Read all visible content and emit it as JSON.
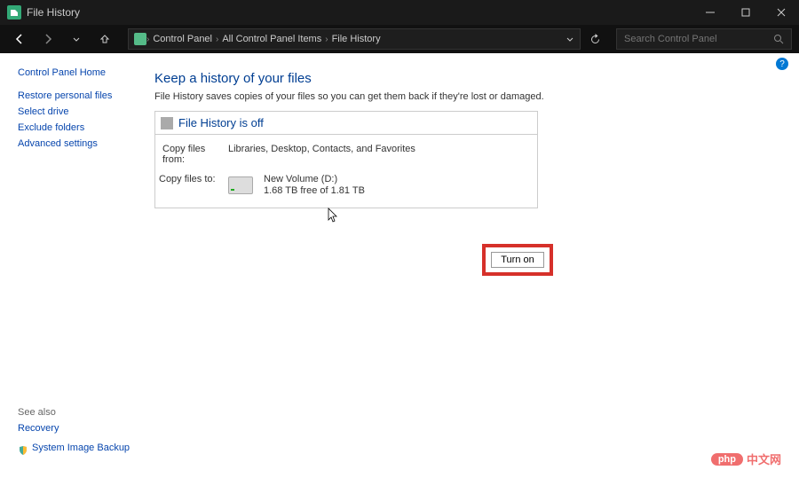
{
  "window": {
    "title": "File History"
  },
  "breadcrumb": {
    "root": "Control Panel",
    "mid": "All Control Panel Items",
    "leaf": "File History"
  },
  "search": {
    "placeholder": "Search Control Panel"
  },
  "sidebar": {
    "home": "Control Panel Home",
    "links": [
      "Restore personal files",
      "Select drive",
      "Exclude folders",
      "Advanced settings"
    ],
    "seealso_label": "See also",
    "seealso": [
      "Recovery",
      "System Image Backup"
    ]
  },
  "main": {
    "heading": "Keep a history of your files",
    "sub": "File History saves copies of your files so you can get them back if they're lost or damaged.",
    "status": "File History is off",
    "copy_from_label": "Copy files from:",
    "copy_from_value": "Libraries, Desktop, Contacts, and Favorites",
    "copy_to_label": "Copy files to:",
    "drive_name": "New Volume (D:)",
    "drive_space": "1.68 TB free of 1.81 TB",
    "turn_on": "Turn on"
  },
  "watermark": {
    "badge": "php",
    "text": "中文网"
  }
}
